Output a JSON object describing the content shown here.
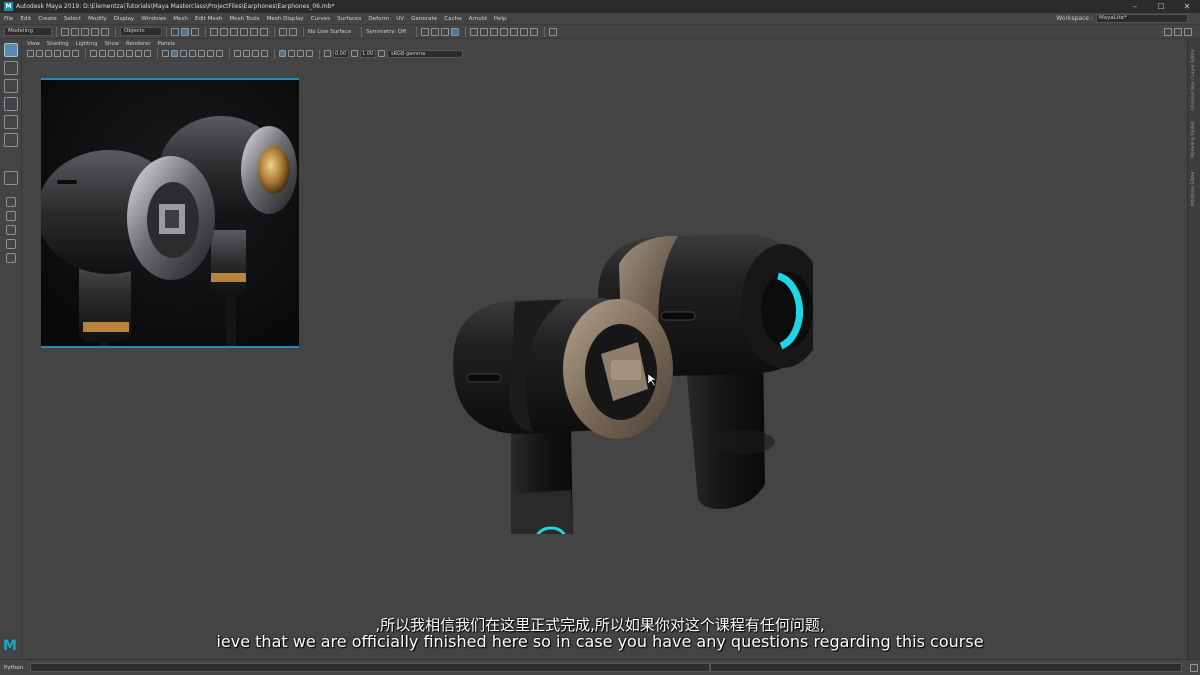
{
  "window": {
    "app_icon": "M",
    "title": "Autodesk Maya 2019: D:\\Elementza\\Tutorials\\Maya Masterclass\\ProjectFiles\\Earphones\\Earphones_06.mb*",
    "controls": [
      "–",
      "☐",
      "✕"
    ]
  },
  "menubar": {
    "items": [
      "File",
      "Edit",
      "Create",
      "Select",
      "Modify",
      "Display",
      "Windows",
      "Mesh",
      "Edit Mesh",
      "Mesh Tools",
      "Mesh Display",
      "Curves",
      "Surfaces",
      "Deform",
      "UV",
      "Generate",
      "Cache",
      "Arnold",
      "Help"
    ],
    "workspace_label": "Workspace :",
    "workspace_value": "MayaLite*"
  },
  "statusline": {
    "mode": "Modeling",
    "objects_label": "Objects",
    "live_surface": "No Live Surface",
    "symmetry": "Symmetry: Off"
  },
  "viewport": {
    "menu": [
      "View",
      "Shading",
      "Lighting",
      "Show",
      "Renderer",
      "Panels"
    ],
    "exposure": "0.00",
    "gamma": "1.00",
    "color_space": "sRGB gamma"
  },
  "right_panel_tabs": [
    "Channel Box / Layer Editor",
    "Modeling Toolkit",
    "Attribute Editor"
  ],
  "subtitles": {
    "chinese": ",所以我相信我们在这里正式完成,所以如果你对这个课程有任何问题,",
    "english": "ieve that we are officially finished here so in case you have any questions regarding this course"
  },
  "command_line": {
    "label": "Python"
  },
  "colors": {
    "accent_cyan": "#1fd6e8",
    "maya_blue": "#19a7c9"
  }
}
